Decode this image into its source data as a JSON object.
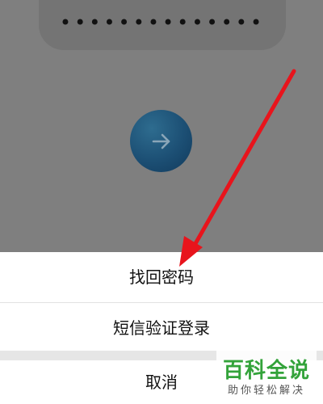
{
  "login": {
    "password_mask": "••••••••••••••"
  },
  "action_sheet": {
    "recover_password_label": "找回密码",
    "sms_login_label": "短信验证登录",
    "cancel_label": "取消"
  },
  "watermark": {
    "title": "百科全说",
    "subtitle": "助你轻松解决"
  },
  "icons": {
    "login_arrow": "arrow-right-icon",
    "annotation": "red-arrow-annotation"
  },
  "colors": {
    "overlay": "#7f7f7f",
    "login_button": "#1c4f74",
    "annotation_arrow": "#e8141c",
    "watermark_green": "#33a33a"
  }
}
